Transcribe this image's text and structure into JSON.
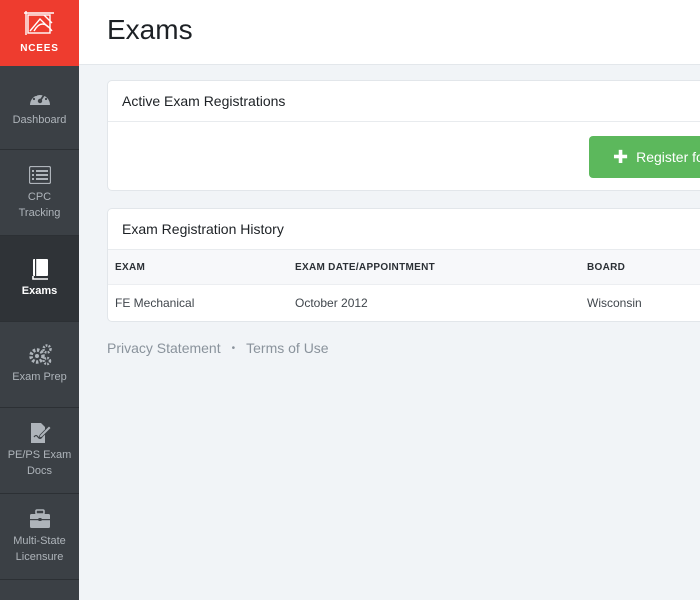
{
  "logo": {
    "text": "NCEES"
  },
  "sidebar": {
    "items": [
      {
        "label": "Dashboard",
        "icon": "dashboard-icon",
        "active": false
      },
      {
        "label": "CPC\nTracking",
        "icon": "list-icon",
        "active": false
      },
      {
        "label": "Exams",
        "icon": "book-icon",
        "active": true
      },
      {
        "label": "Exam Prep",
        "icon": "gears-icon",
        "active": false
      },
      {
        "label": "PE/PS Exam\nDocs",
        "icon": "document-edit-icon",
        "active": false
      },
      {
        "label": "Multi-State\nLicensure",
        "icon": "briefcase-icon",
        "active": false
      }
    ]
  },
  "header": {
    "title": "Exams"
  },
  "active_registrations": {
    "title": "Active Exam Registrations",
    "register_button": "Register fo"
  },
  "history": {
    "title": "Exam Registration History",
    "columns": [
      "EXAM",
      "EXAM DATE/APPOINTMENT",
      "BOARD"
    ],
    "rows": [
      [
        "FE Mechanical",
        "October 2012",
        "Wisconsin"
      ]
    ]
  },
  "footer": {
    "privacy": "Privacy Statement",
    "separator": "•",
    "terms": "Terms of Use"
  },
  "colors": {
    "brand": "#ee3c2f",
    "sidebar": "#3b4045",
    "success": "#5cb85c"
  }
}
